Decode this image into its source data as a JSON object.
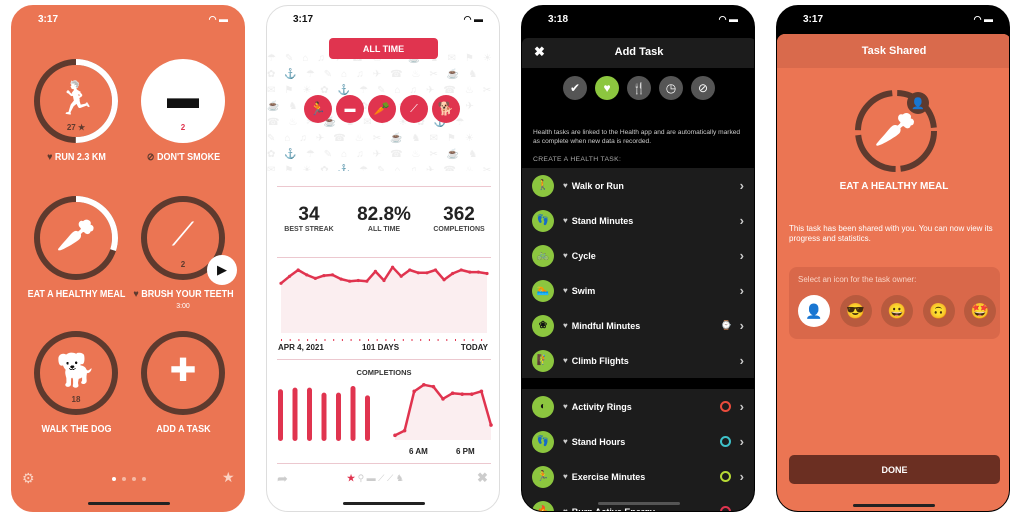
{
  "colors": {
    "orange": "#EB7553",
    "brown": "#5E3A2E",
    "crimson": "#E0344F",
    "green": "#8CC63F",
    "dark": "#1C1C1C",
    "done": "#6B2F22"
  },
  "screen1": {
    "time": "3:17",
    "tasks": [
      {
        "label": "RUN 2.3 KM",
        "badge": "heart-icon",
        "count": "27 ★",
        "icon": "running-icon",
        "progress": 0.5
      },
      {
        "label": "DON'T SMOKE",
        "badge": "no-icon",
        "count": "2",
        "icon": "cigarette-icon",
        "progress": 1
      },
      {
        "label": "EAT A HEALTHY MEAL",
        "badge": "",
        "count": "",
        "icon": "carrot-icon",
        "progress": 0.3
      },
      {
        "label": "BRUSH YOUR TEETH",
        "badge": "heart-icon",
        "count": "2",
        "icon": "toothbrush-icon",
        "progress": 0,
        "sublabel": "3:00"
      },
      {
        "label": "WALK THE DOG",
        "badge": "",
        "count": "18",
        "icon": "dog-icon",
        "progress": 0
      },
      {
        "label": "ADD A TASK",
        "badge": "",
        "count": "",
        "icon": "plus-icon",
        "progress": 0
      }
    ],
    "page_count": 4,
    "current_page": 1
  },
  "screen2": {
    "time": "3:17",
    "range_button": "ALL TIME",
    "stats": [
      {
        "value": "34",
        "label": "BEST STREAK"
      },
      {
        "value": "82.8%",
        "label": "ALL TIME"
      },
      {
        "value": "362",
        "label": "COMPLETIONS"
      }
    ],
    "date_start": "APR 4, 2021",
    "date_span": "101 DAYS",
    "date_end": "TODAY",
    "completions_title": "COMPLETIONS",
    "hour_labels": [
      "6 AM",
      "6 PM"
    ]
  },
  "chart_data": [
    {
      "type": "area",
      "values": [
        71,
        81,
        90,
        83,
        78,
        82,
        83,
        77,
        74,
        75,
        74,
        88,
        75,
        94,
        81,
        90,
        86,
        86,
        90,
        76,
        85,
        90,
        87,
        87,
        85
      ]
    },
    {
      "type": "bar",
      "values": [
        94,
        97,
        97,
        88,
        88,
        100,
        83
      ]
    },
    {
      "type": "area",
      "values": [
        5,
        10,
        52,
        59,
        57,
        44,
        50,
        49,
        49,
        52,
        16
      ]
    }
  ],
  "screen3": {
    "time": "3:18",
    "title": "Add Task",
    "info": "Health tasks are linked to the Health app and are automatically marked as complete when new data is recorded.",
    "section": "CREATE A HEALTH TASK:",
    "group1": [
      {
        "label": "Walk or Run",
        "glyph": "🚶"
      },
      {
        "label": "Stand Minutes",
        "glyph": "👣"
      },
      {
        "label": "Cycle",
        "glyph": "🚲"
      },
      {
        "label": "Swim",
        "glyph": "🏊"
      },
      {
        "label": "Mindful Minutes",
        "glyph": "❀",
        "accessory": "watch-icon"
      },
      {
        "label": "Climb Flights",
        "glyph": "🧗"
      }
    ],
    "group2": [
      {
        "label": "Activity Rings",
        "glyph": "◐",
        "ring": "#E94B3C"
      },
      {
        "label": "Stand Hours",
        "glyph": "👣",
        "ring": "#3EC1C9"
      },
      {
        "label": "Exercise Minutes",
        "glyph": "🏃",
        "ring": "#B6D935"
      },
      {
        "label": "Burn Active Energy",
        "glyph": "🔥",
        "ring": "#E0344F"
      }
    ]
  },
  "screen4": {
    "time": "3:17",
    "title": "Task Shared",
    "task": "EAT A HEALTHY MEAL",
    "message": "This task has been shared with you. You can now view its progress and statistics.",
    "picker_label": "Select an icon for the task owner:",
    "owner_icons": [
      "👤",
      "😎",
      "😀",
      "🙃",
      "🤩"
    ],
    "done": "DONE"
  }
}
